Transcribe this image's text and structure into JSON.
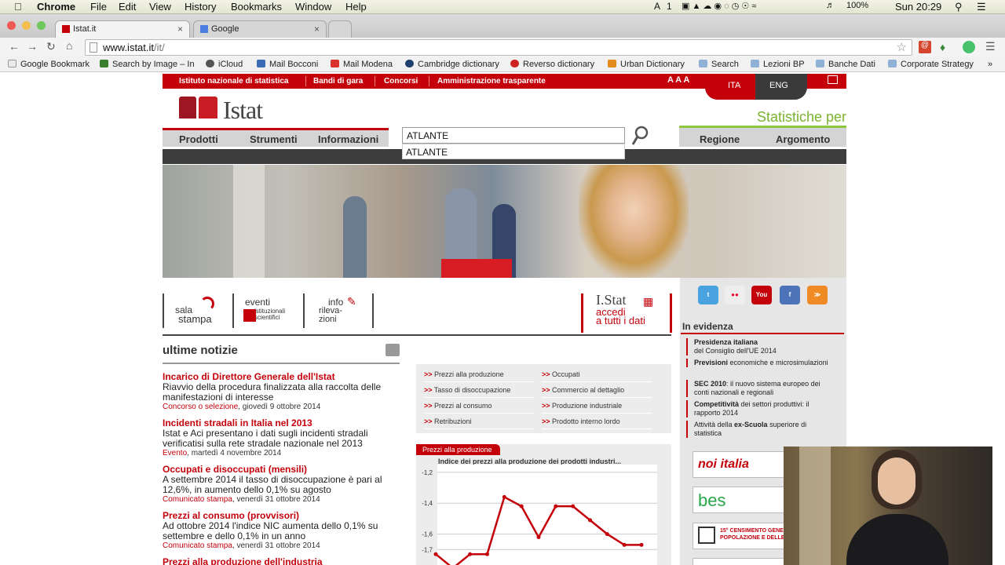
{
  "menubar": {
    "app": "Chrome",
    "items": [
      "File",
      "Edit",
      "View",
      "History",
      "Bookmarks",
      "Window",
      "Help"
    ],
    "battery": "100%",
    "clock": "Sun 20:29",
    "input_count": "1"
  },
  "tabs": [
    {
      "label": "Istat.it",
      "active": true
    },
    {
      "label": "Google",
      "active": false
    }
  ],
  "omnibox": {
    "url_host": "www.istat.it",
    "url_path": "/it/"
  },
  "bookmarks": [
    {
      "label": "Google Bookmark",
      "color": "#888"
    },
    {
      "label": "Search by Image – In",
      "color": "#3a7d2c"
    },
    {
      "label": "iCloud",
      "color": "#555"
    },
    {
      "label": "Mail Bocconi",
      "color": "#3b6bb5"
    },
    {
      "label": "Mail Modena",
      "color": "#d9312b"
    },
    {
      "label": "Cambridge dictionary",
      "color": "#1f3f6e"
    },
    {
      "label": "Reverso dictionary",
      "color": "#c22"
    },
    {
      "label": "Urban Dictionary",
      "color": "#e48b1c"
    },
    {
      "label": "Search",
      "color": "#8fb1d6"
    },
    {
      "label": "Lezioni BP",
      "color": "#8fb1d6"
    },
    {
      "label": "Banche Dati",
      "color": "#8fb1d6"
    },
    {
      "label": "Corporate Strategy",
      "color": "#8fb1d6"
    }
  ],
  "site": {
    "topbar": [
      "Istituto nazionale di statistica",
      "Bandi di gara",
      "Concorsi",
      "Amministrazione trasparente"
    ],
    "font_sizes": "A A A",
    "lang_ita": "ITA",
    "lang_eng": "ENG",
    "logo": "Istat",
    "nav_left": [
      "Prodotti",
      "Strumenti",
      "Informazioni"
    ],
    "nav_right": [
      "Regione",
      "Argomento"
    ],
    "search_value": "ATLANTE",
    "suggestion": "ATLANTE",
    "stat_per": "Statistiche per",
    "tools": [
      {
        "l1": "sala",
        "l2": "stampa"
      },
      {
        "l1": "eventi",
        "l2": "istituzionali scientifici"
      },
      {
        "l1": "info",
        "l2": "rileva-zioni"
      }
    ],
    "istat_box": {
      "l1": "I.Stat",
      "l2": "accedi",
      "l3": "a tutti i dati"
    },
    "news_title": "ultime notizie",
    "news": [
      {
        "h": "Incarico di Direttore Generale dell'Istat",
        "b": "Riavvio della procedura finalizzata alla raccolta delle manifestazioni di interesse",
        "cat": "Concorso o selezione",
        "date": ", giovedì 9 ottobre 2014"
      },
      {
        "h": "Incidenti stradali in Italia nel 2013",
        "b": "Istat e Aci presentano i dati sugli incidenti stradali verificatisi sulla rete stradale nazionale nel 2013",
        "cat": "Evento",
        "date": ", martedì 4 novembre 2014"
      },
      {
        "h": "Occupati e disoccupati (mensili)",
        "b": "A settembre 2014 il tasso di disoccupazione è pari al 12,6%, in aumento dello 0,1% su agosto",
        "cat": "Comunicato stampa",
        "date": ", venerdì 31 ottobre 2014"
      },
      {
        "h": "Prezzi al consumo (provvisori)",
        "b": "Ad ottobre 2014 l'indice NIC aumenta dello 0,1% su settembre e dello 0,1% in un anno",
        "cat": "Comunicato stampa",
        "date": ", venerdì 31 ottobre 2014"
      },
      {
        "h": "Prezzi alla produzione dell'industria",
        "b": "",
        "cat": "",
        "date": ""
      }
    ],
    "links_left": [
      "Prezzi alla produzione",
      "Tasso di disoccupazione",
      "Prezzi al consumo",
      "Retribuzioni"
    ],
    "links_right": [
      "Occupati",
      "Commercio al dettaglio",
      "Produzione industriale",
      "Prodotto interno lordo"
    ],
    "chart_tab": "Prezzi alla produzione",
    "chart_title": "Indice dei prezzi alla produzione dei prodotti industri...",
    "evidenza_title": "In evidenza",
    "evidenza": [
      {
        "bold": "Presidenza italiana",
        "rest": "del Consiglio dell'UE 2014"
      },
      {
        "bold": "Previsioni",
        "rest": " economiche e microsimulazioni"
      },
      {
        "bold": "SEC 2010",
        "rest": ": il  nuovo sistema europeo dei conti nazionali e regionali"
      },
      {
        "bold": "Competitività",
        "rest": " dei settori produttivi: il rapporto 2014"
      },
      {
        "bold": "ex-Scuola",
        "pre": "Attività della ",
        "rest": " superiore di statistica"
      }
    ],
    "banners": [
      "noi italia",
      "bes",
      "15° CENSIMENTO GENERALE DELLA POPOLAZIONE E DELLE"
    ],
    "social": [
      "twitter-icon",
      "flickr-icon",
      "youtube-icon",
      "facebook-icon",
      "rss-icon"
    ]
  },
  "chart_data": {
    "type": "line",
    "title": "Indice dei prezzi alla produzione dei prodotti industri...",
    "y_ticks": [
      "-1,2",
      "-1,4",
      "-1,6",
      "-1,7"
    ],
    "ylim": [
      -1.8,
      -1.15
    ],
    "series": [
      {
        "values": [
          -1.73,
          -1.82,
          -1.73,
          -1.73,
          -1.36,
          -1.42,
          -1.62,
          -1.42,
          -1.42,
          -1.51,
          -1.6,
          -1.67,
          -1.67
        ]
      }
    ]
  }
}
